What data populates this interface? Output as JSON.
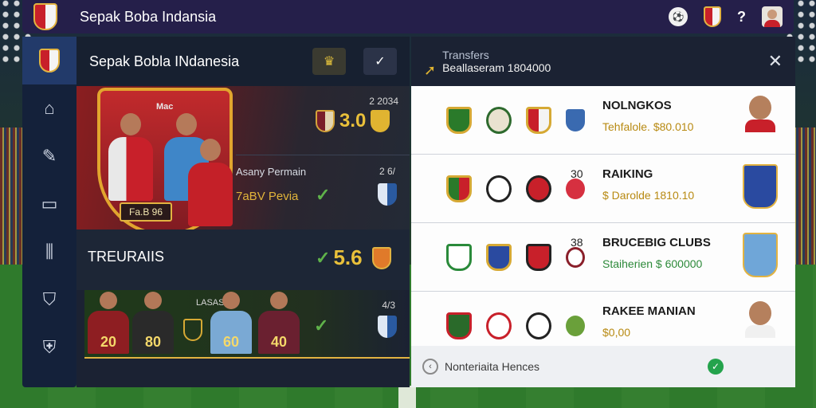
{
  "app": {
    "title": "Sepak Boba Indansia"
  },
  "main": {
    "header_title": "Sepak Bobla INdanesia",
    "feature": {
      "badge_top_text": "2 2034",
      "rating": "3.0",
      "label_top": "Asany Permain",
      "label_bottom": "7aBV Pevia",
      "num_right": "2 6/",
      "shield_text": "Fa.B 96",
      "poster_text": "Mac"
    },
    "section2": {
      "title": "TREURAIIS",
      "rating": "5.6",
      "prefix": "✓"
    },
    "section3": {
      "label": "LASASIOS",
      "num": "4/3",
      "players": [
        "20",
        "80",
        "60",
        "40"
      ]
    }
  },
  "transfers": {
    "title": "Transfers",
    "subtitle": "Beallaseram 1804000",
    "items": [
      {
        "name": "NOLNGKOS",
        "price": "Tehfalole. $80.010",
        "price_color": "#b88a12",
        "num": ""
      },
      {
        "name": "RAIKING",
        "price": "$ Darolde 1810.10",
        "price_color": "#b88a12",
        "num": "30"
      },
      {
        "name": "BRUCEBIG CLUBS",
        "price": "Staiherien $ 600000",
        "price_color": "#2d8a3a",
        "num": "38"
      },
      {
        "name": "RAKEE MANIAN",
        "price": "$0,00",
        "price_color": "#b88a12",
        "num": ""
      }
    ],
    "footer_text": "Nonteriaita Hences"
  },
  "colors": {
    "topbar": "#251f4a",
    "panel": "#1b2233",
    "gold": "#e9c03a",
    "accent_red": "#c8202a",
    "green": "#5fb24a"
  },
  "icons": {
    "nav": [
      "home-icon",
      "edit-icon",
      "window-icon",
      "stats-icon",
      "trophy-icon",
      "shield-icon"
    ]
  }
}
